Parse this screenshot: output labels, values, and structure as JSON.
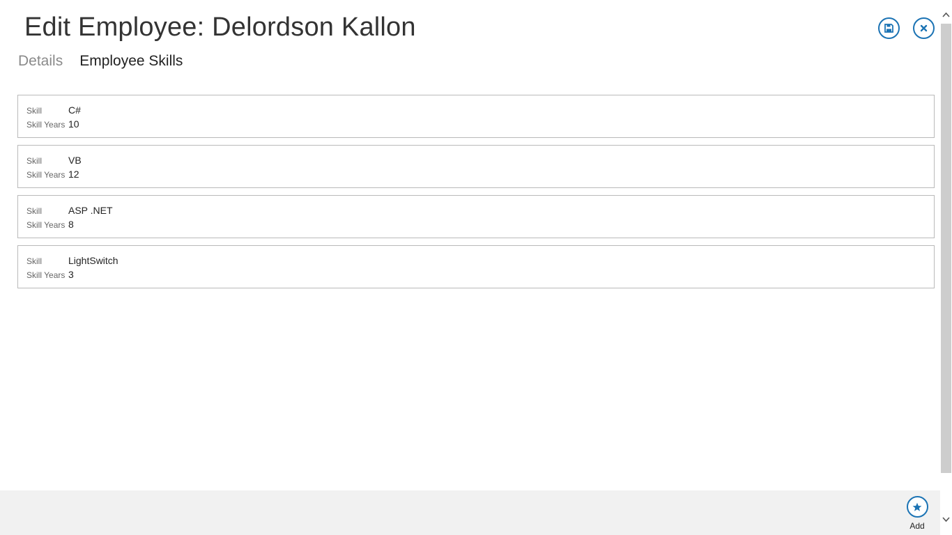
{
  "header": {
    "title": "Edit Employee: Delordson Kallon",
    "save_icon": "save-icon",
    "close_icon": "close-icon"
  },
  "tabs": [
    {
      "label": "Details",
      "active": false
    },
    {
      "label": "Employee Skills",
      "active": true
    }
  ],
  "skills": [
    {
      "skill_label": "Skill",
      "skill": "C#",
      "years_label": "Skill Years",
      "years": "10"
    },
    {
      "skill_label": "Skill",
      "skill": "VB",
      "years_label": "Skill Years",
      "years": "12"
    },
    {
      "skill_label": "Skill",
      "skill": "ASP .NET",
      "years_label": "Skill Years",
      "years": "8"
    },
    {
      "skill_label": "Skill",
      "skill": "LightSwitch",
      "years_label": "Skill Years",
      "years": "3"
    }
  ],
  "app_bar": {
    "add_label": "Add",
    "add_icon": "star-icon"
  },
  "colors": {
    "accent": "#1b73b4",
    "app_bar_bg": "#f1f1f1",
    "card_border": "#b9b9b9"
  }
}
